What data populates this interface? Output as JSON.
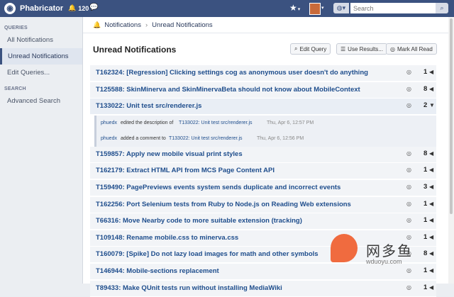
{
  "topbar": {
    "brand": "Phabricator",
    "notification_count": "120",
    "search_placeholder": "Search"
  },
  "sidebar": {
    "queries_header": "QUERIES",
    "items": [
      {
        "label": "All Notifications"
      },
      {
        "label": "Unread Notifications"
      },
      {
        "label": "Edit Queries..."
      }
    ],
    "search_header": "SEARCH",
    "advanced_search": "Advanced Search"
  },
  "breadcrumb": {
    "root": "Notifications",
    "current": "Unread Notifications"
  },
  "header": {
    "title": "Unread Notifications",
    "edit_query": "Edit Query",
    "use_results": "Use Results...",
    "mark_all_read": "Mark All Read"
  },
  "notifications": [
    {
      "title": "T162324: [Regression] Clicking settings cog as anonymous user doesn't do anything",
      "count": "1",
      "arrow": "◀"
    },
    {
      "title": "T125588: SkinMinerva and SkinMinervaBeta should not know about MobileContext",
      "count": "8",
      "arrow": "◀"
    },
    {
      "title": "T133022: Unit test src/renderer.js",
      "count": "2",
      "arrow": "▼"
    },
    {
      "title": "T159857: Apply new mobile visual print styles",
      "count": "8",
      "arrow": "◀"
    },
    {
      "title": "T162179: Extract HTML API from MCS Page Content API",
      "count": "1",
      "arrow": "◀"
    },
    {
      "title": "T159490: PagePreviews events system sends duplicate and incorrect events",
      "count": "3",
      "arrow": "◀"
    },
    {
      "title": "T162256: Port Selenium tests from Ruby to Node.js on Reading Web extensions",
      "count": "1",
      "arrow": "◀"
    },
    {
      "title": "T66316: Move Nearby code to more suitable extension (tracking)",
      "count": "1",
      "arrow": "◀"
    },
    {
      "title": "T109148: Rename mobile.css to minerva.css",
      "count": "1",
      "arrow": "◀"
    },
    {
      "title": "T160079: [Spike] Do not lazy load images for math and other symbols",
      "count": "8",
      "arrow": "◀"
    },
    {
      "title": "T146944: Mobile-sections replacement",
      "count": "1",
      "arrow": "◀"
    },
    {
      "title": "T89433: Make QUnit tests run without installing MediaWiki",
      "count": "1",
      "arrow": "◀"
    }
  ],
  "details": [
    {
      "user": "phuedx",
      "action": "edited the description of",
      "task": "T133022: Unit test src/renderer.js",
      "time": "Thu, Apr 6, 12:57 PM"
    },
    {
      "user": "phuedx",
      "action": "added a comment to",
      "task": "T133022: Unit test src/renderer.js",
      "time": "Thu, Apr 6, 12:56 PM"
    }
  ],
  "watermark": {
    "text": "网多鱼",
    "url": "wduoyu.com"
  }
}
